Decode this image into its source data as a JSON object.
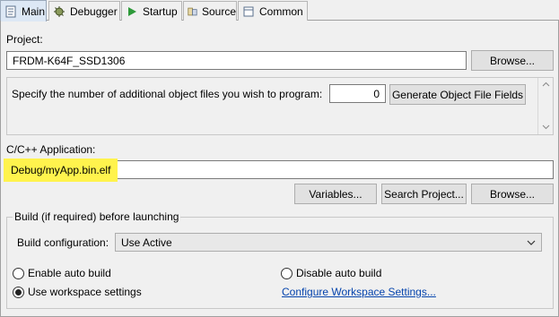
{
  "tabs": [
    {
      "label": "Main",
      "icon": "page-icon",
      "active": true
    },
    {
      "label": "Debugger",
      "icon": "bug-gear-icon"
    },
    {
      "label": "Startup",
      "icon": "play-icon"
    },
    {
      "label": "Source",
      "icon": "source-icon"
    },
    {
      "label": "Common",
      "icon": "common-icon"
    }
  ],
  "project": {
    "label": "Project:",
    "value": "FRDM-K64F_SSD1306",
    "browse_label": "Browse..."
  },
  "object_files": {
    "prompt": "Specify the number of additional object files you wish to program:",
    "count": "0",
    "generate_label": "Generate Object File Fields"
  },
  "application": {
    "label": "C/C++ Application:",
    "value": "Debug/myApp.bin.elf",
    "variables_label": "Variables...",
    "search_label": "Search Project...",
    "browse_label": "Browse..."
  },
  "build": {
    "group_label": "Build (if required) before launching",
    "config_label": "Build configuration:",
    "config_value": "Use Active",
    "enable_auto": "Enable auto build",
    "disable_auto": "Disable auto build",
    "workspace_settings": "Use workspace settings",
    "configure_link": "Configure Workspace Settings...",
    "selected": "workspace_settings"
  },
  "colors": {
    "highlight": "#fff34d",
    "link": "#0645ad"
  }
}
